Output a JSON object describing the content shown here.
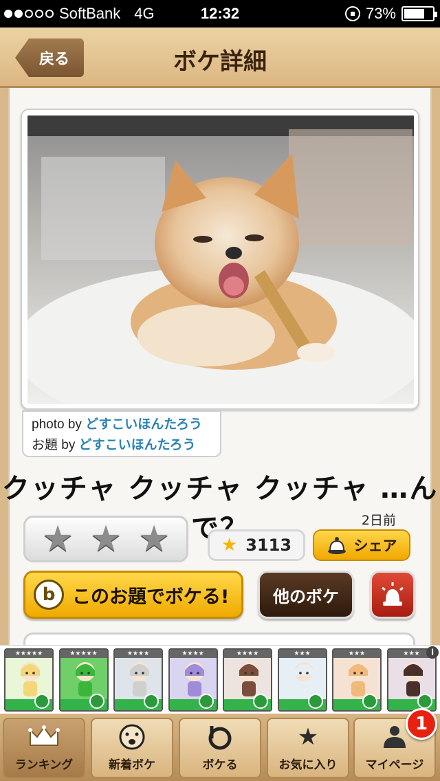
{
  "status_bar": {
    "carrier": "SoftBank",
    "network": "4G",
    "time": "12:32",
    "battery_percent": "73%",
    "battery_level": 0.73,
    "signal_bars": 2
  },
  "header": {
    "back_label": "戻る",
    "title": "ボケ詳細"
  },
  "photo": {
    "description_icon": "chihuahua-photo",
    "credit": {
      "photo_label": "photo by",
      "photo_user": "どすこいほんたろう",
      "topic_label": "お題 by",
      "topic_user": "どすこいほんたろう"
    }
  },
  "boke": {
    "text": "クッチャ クッチャ クッチャ …んで？",
    "time_ago": "2日前",
    "star_count": "3113"
  },
  "actions": {
    "share_label": "シェア",
    "boke_label": "このお題でボケる!",
    "other_label": "他のボケ"
  },
  "characters": [
    {
      "stars": "★★★★★"
    },
    {
      "stars": "★★★★★"
    },
    {
      "stars": "★★★★"
    },
    {
      "stars": "★★★★"
    },
    {
      "stars": "★★★★"
    },
    {
      "stars": "★★★"
    },
    {
      "stars": "★★★"
    },
    {
      "stars": "★★★"
    }
  ],
  "tabs": [
    {
      "label": "ランキング",
      "icon": "crown-icon"
    },
    {
      "label": "新着ボケ",
      "icon": "face-icon"
    },
    {
      "label": "ボケる",
      "icon": "b-logo-icon"
    },
    {
      "label": "お気に入り",
      "icon": "star-icon"
    },
    {
      "label": "マイページ",
      "icon": "user-icon"
    }
  ],
  "notification_badge": "1",
  "colors": {
    "accent_yellow": "#f0aa00",
    "link_blue": "#2a82b5",
    "badge_red": "#e82010"
  }
}
